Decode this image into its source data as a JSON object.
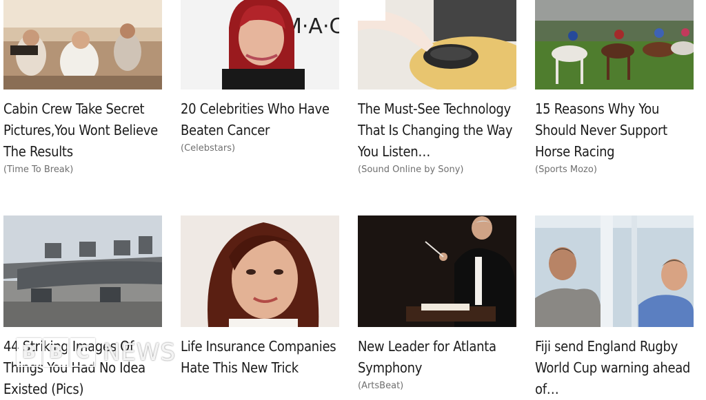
{
  "cards": [
    {
      "title": "Cabin Crew Take Secret Pictures,You Wont Believe The Results",
      "source": "(Time To Break)"
    },
    {
      "title": "20 Celebrities Who Have Beaten Cancer",
      "source": "(Celebstars)"
    },
    {
      "title": "The Must-See Technology That Is Changing the Way You Listen…",
      "source": "(Sound Online by Sony)"
    },
    {
      "title": "15 Reasons Why You Should Never Support Horse Racing",
      "source": "(Sports Mozo)"
    },
    {
      "title": "44 Striking Images Of Things You Had No Idea Existed (Pics)",
      "source": ""
    },
    {
      "title": "Life Insurance Companies Hate This New Trick",
      "source": ""
    },
    {
      "title": "New Leader for Atlanta Symphony",
      "source": "(ArtsBeat)"
    },
    {
      "title": "Fiji send England Rugby World Cup warning ahead of…",
      "source": ""
    }
  ],
  "watermark": {
    "letters": [
      "B",
      "B",
      "C"
    ],
    "news": "NEWS"
  }
}
